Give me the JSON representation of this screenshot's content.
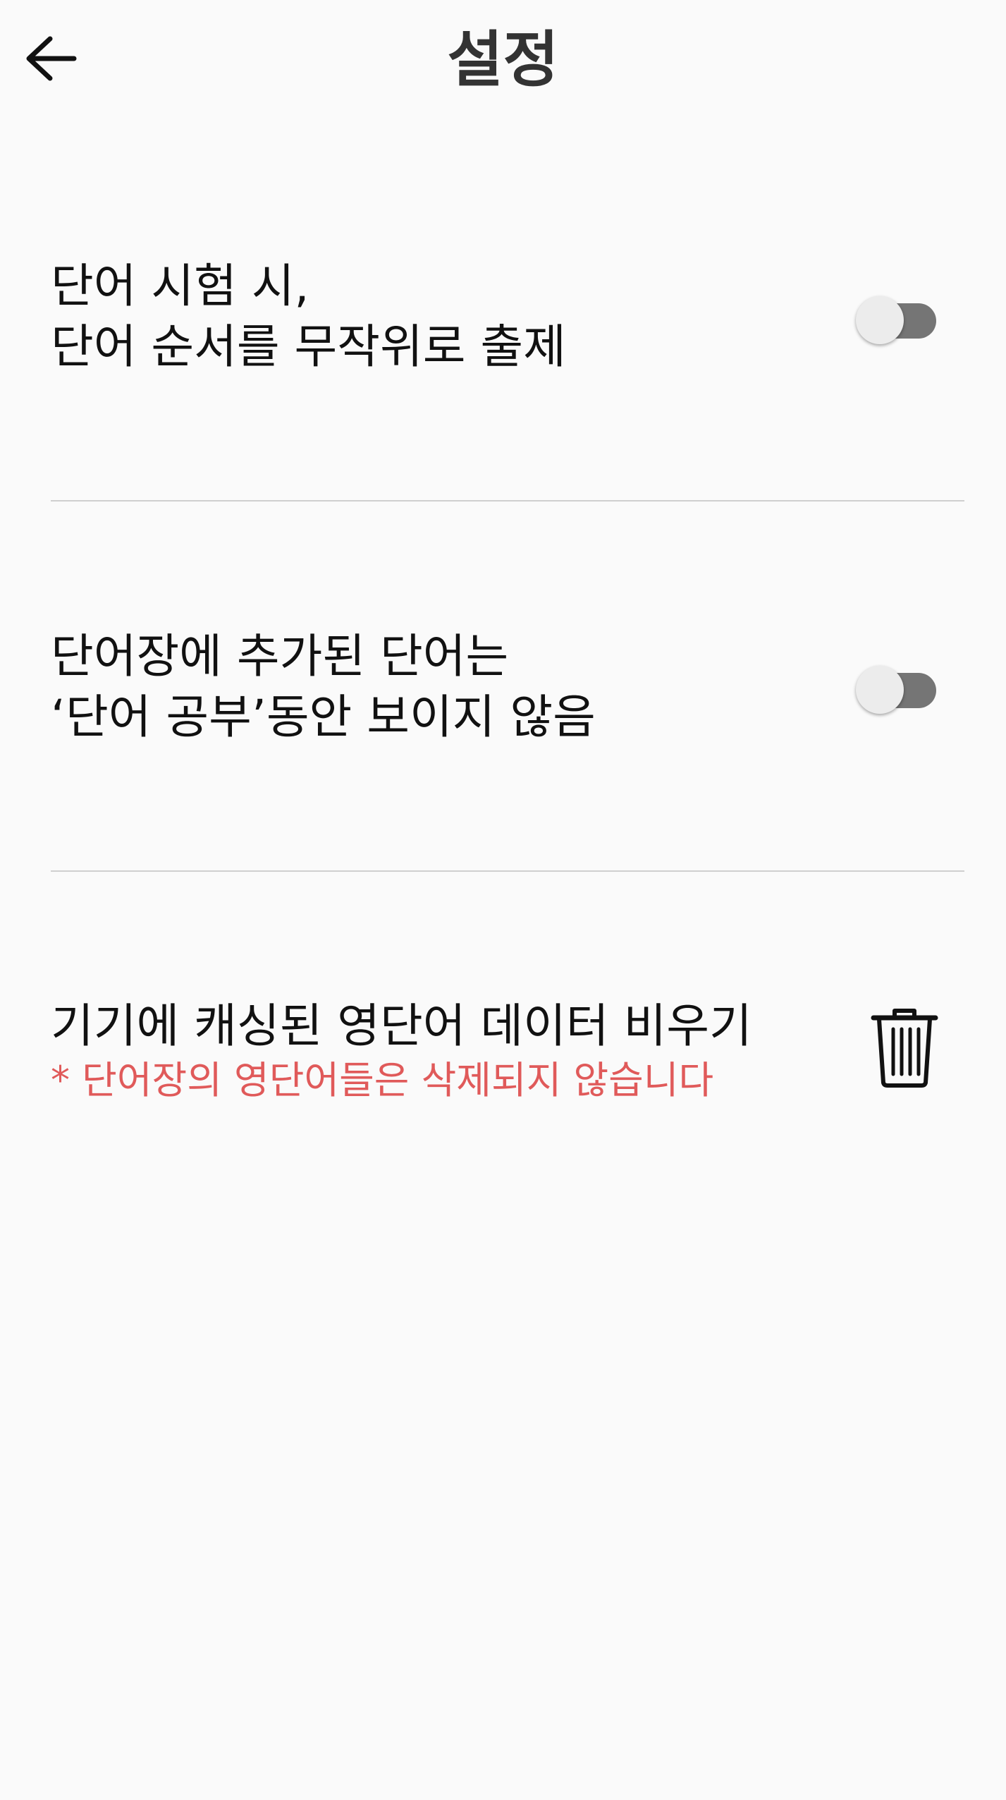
{
  "header": {
    "title": "설정",
    "back_icon": "arrow-left-icon"
  },
  "settings": {
    "shuffle_quiz": {
      "label_line1": "단어 시험 시,",
      "label_line2": "단어 순서를 무작위로 출제",
      "enabled": false
    },
    "hide_added_words": {
      "label_line1": "단어장에 추가된 단어는",
      "label_line2": "‘단어 공부’동안 보이지 않음",
      "enabled": false
    },
    "clear_cache": {
      "label": "기기에 캐싱된 영단어 데이터 비우기",
      "warning": "* 단어장의 영단어들은 삭제되지 않습니다",
      "icon": "trash-icon"
    }
  },
  "colors": {
    "background": "#fafafa",
    "title": "#333333",
    "text": "#111111",
    "warning": "#e05a5a",
    "toggle_track_off": "#757575",
    "toggle_thumb_off": "#ececec",
    "divider": "#cfcfcf"
  }
}
